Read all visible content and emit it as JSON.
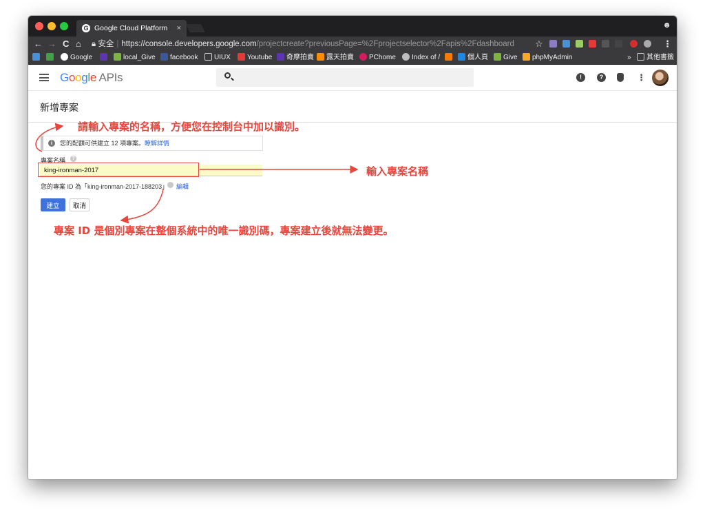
{
  "browser": {
    "tab_title": "Google Cloud Platform",
    "tab_close": "×",
    "secure_label": "安全",
    "url_host": "https://console.developers.google.com",
    "url_path": "/projectcreate?previousPage=%2Fprojectselector%2Fapis%2Fdashboard",
    "nav": {
      "back": "←",
      "forward": "→",
      "reload": "C",
      "home": "⌂"
    },
    "star": "☆",
    "menu": "⋮"
  },
  "bookmarks": {
    "items": [
      {
        "label": "Google",
        "color": "#ffffff"
      },
      {
        "label": "local_Give",
        "color": "#7cb342"
      },
      {
        "label": "facebook",
        "color": "#3b5998"
      },
      {
        "label": "UIUX",
        "color": "#9e9e9e"
      },
      {
        "label": "Youtube",
        "color": "#e53935"
      },
      {
        "label": "奇摩拍賣",
        "color": "#5e35b1"
      },
      {
        "label": "露天拍賣",
        "color": "#fb8c00"
      },
      {
        "label": "PChome",
        "color": "#d81b60"
      },
      {
        "label": "Index of /",
        "color": "#bdbdbd"
      },
      {
        "label": "個人頁",
        "color": "#1e88e5"
      },
      {
        "label": "Give",
        "color": "#7cb342"
      },
      {
        "label": "phpMyAdmin",
        "color": "#f9a825"
      }
    ],
    "more": "»",
    "other_folder": "其他書籤"
  },
  "header": {
    "logo_google": "Google",
    "logo_apis": "APIs",
    "colors": [
      "#4285f4",
      "#ea4335",
      "#fbbc05",
      "#4285f4",
      "#34a853",
      "#ea4335"
    ]
  },
  "page": {
    "title": "新增專案",
    "notice_text": "您的配額可供建立 12 項專案。",
    "notice_link": "瞭解詳情",
    "name_label": "專案名稱",
    "name_value": "king-ironman-2017",
    "project_id_text": "您的專案 ID 為「king-ironman-2017-188203」",
    "edit_link": "編輯",
    "create_button": "建立",
    "cancel_button": "取消"
  },
  "annotations": {
    "top": "請輸入專案的名稱，方便您在控制台中加以識別。",
    "right": "輸入專案名稱",
    "bottom": "專案 ID 是個別專案在整個系統中的唯一識別碼，專案建立後就無法變更。",
    "color": "#e8453c"
  }
}
